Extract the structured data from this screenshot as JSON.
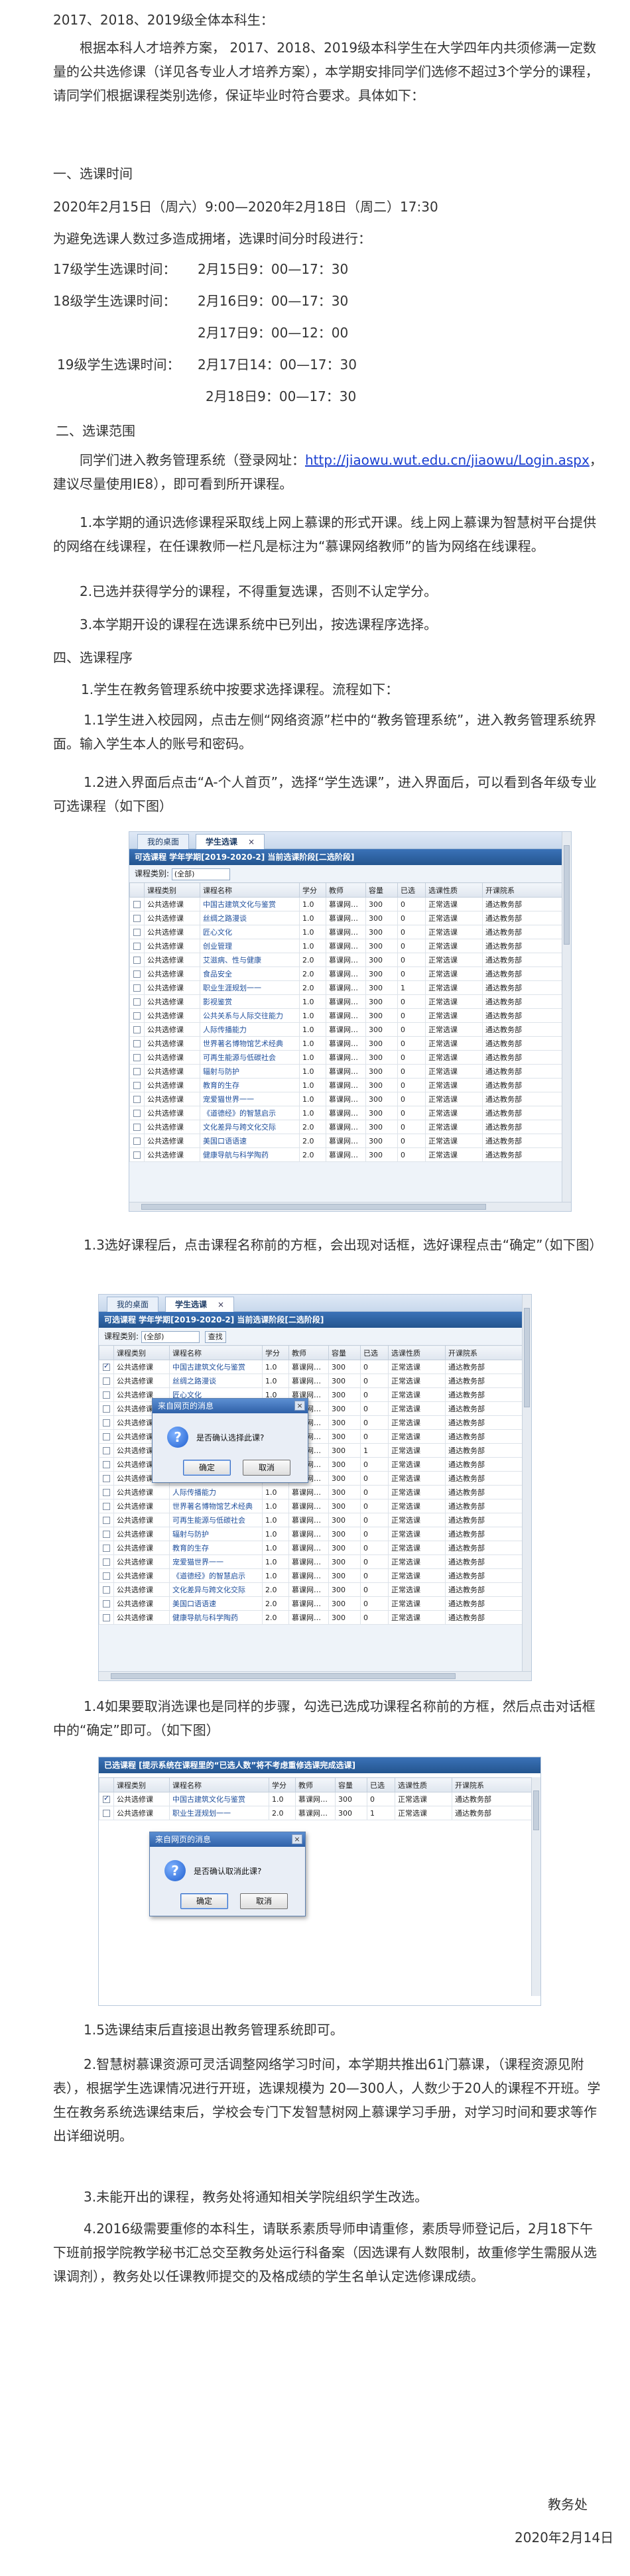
{
  "intro": {
    "audience": "2017、2018、2019级全体本科生：",
    "body": "根据本科人才培养方案， 2017、2018、2019级本科学生在大学四年内共须修满一定数量的公共选修课（详见各专业人才培养方案），本学期安排同学们选修不超过3个学分的课程，请同学们根据课程类别选修，保证毕业时符合要求。具体如下："
  },
  "section1": {
    "heading": "一、选课时间",
    "period": "2020年2月15日（周六）9:00—2020年2月18日（周二）17:30",
    "note": "为避免选课人数过多造成拥堵，选课时间分时段进行：",
    "rows": [
      {
        "grade": "17级学生选课时间：",
        "time": "2月15日9：00—17：30"
      },
      {
        "grade": "18级学生选课时间：",
        "time": "2月16日9：00—17：30"
      },
      {
        "grade": "",
        "time": "2月17日9：00—12：00"
      },
      {
        "grade": "19级学生选课时间：",
        "time": "2月17日14：00—17：30"
      },
      {
        "grade": "",
        "time": "2月18日9：00—17：30"
      }
    ]
  },
  "section2": {
    "heading": "二、选课范围",
    "p1_before": "同学们进入教务管理系统（登录网址：",
    "p1_link": "http://jiaowu.wut.edu.cn/jiaowu/Login.aspx",
    "p1_after": "，建议尽量使用IE8），即可看到所开课程。",
    "p2": "1.本学期的通识选修课程采取线上网上慕课的形式开课。线上网上慕课为智慧树平台提供的网络在线课程，在任课教师一栏凡是标注为“慕课网络教师”的皆为网络在线课程。",
    "p3": "2.已选并获得学分的课程，不得重复选课，否则不认定学分。",
    "p4": "3.本学期开设的课程在选课系统中已列出，按选课程序选择。"
  },
  "section4": {
    "heading": "四、选课程序",
    "s1": "1.学生在教务管理系统中按要求选择课程。流程如下：",
    "s11": "1.1学生进入校园网，点击左侧“网络资源”栏中的“教务管理系统”，进入教务管理系统界面。输入学生本人的账号和密码。",
    "s12": "1.2进入界面后点击“A-个人首页”，选择“学生选课”，进入界面后，可以看到各年级专业可选课程（如下图）",
    "s13": "1.3选好课程后，点击课程名称前的方框，会出现对话框，选好课程点击“确定”（如下图）",
    "s14": "1.4如果要取消选课也是同样的步骤，勾选已选成功课程名称前的方框，然后点击对话框中的“确定”即可。（如下图）",
    "s15": "1.5选课结束后直接退出教务管理系统即可。",
    "s2": "2.智慧树慕课资源可灵活调整网络学习时间，本学期共推出61门慕课，（课程资源见附表），根据学生选课情况进行开班，选课规模为 20—300人，人数少于20人的课程不开班。学生在教务系统选课结束后，学校会专门下发智慧树网上慕课学习手册，对学习时间和要求等作出详细说明。",
    "s3": "3.未能开出的课程，教务处将通知相关学院组织学生改选。",
    "s4": "4.2016级需要重修的本科生，请联系素质导师申请重修，素质导师登记后，2月18下午下班前报学院教学秘书汇总交至教务处运行科备案（因选课有人数限制，故重修学生需服从选课调剂），教务处以任课教师提交的及格成绩的学生名单认定选修课成绩。"
  },
  "footer": {
    "org": "教务处",
    "date": "2020年2月14日"
  },
  "shots": {
    "tabs": [
      "我的桌面",
      "学生选课"
    ],
    "close_mark": "×",
    "title": "可选课程  学年学期[2019-2020-2]   当前选课阶段[二选阶段]",
    "filter_label": "课程类别:",
    "filter_value": "(全部)",
    "filter_button": "查找",
    "headers": [
      "课程类别",
      "课程名称",
      "学分",
      "教师",
      "容量",
      "已选",
      "选课性质",
      "开课院系"
    ],
    "rows": [
      [
        "公共选修课",
        "中国古建筑文化与鉴赏",
        "1.0",
        "慕课网…",
        "300",
        "0",
        "正常选课",
        "通达教务部"
      ],
      [
        "公共选修课",
        "丝绸之路漫谈",
        "1.0",
        "慕课网…",
        "300",
        "0",
        "正常选课",
        "通达教务部"
      ],
      [
        "公共选修课",
        "匠心文化",
        "1.0",
        "慕课网…",
        "300",
        "0",
        "正常选课",
        "通达教务部"
      ],
      [
        "公共选修课",
        "创业管理",
        "1.0",
        "慕课网…",
        "300",
        "0",
        "正常选课",
        "通达教务部"
      ],
      [
        "公共选修课",
        "艾滋病、性与健康",
        "2.0",
        "慕课网…",
        "300",
        "0",
        "正常选课",
        "通达教务部"
      ],
      [
        "公共选修课",
        "食品安全",
        "2.0",
        "慕课网…",
        "300",
        "0",
        "正常选课",
        "通达教务部"
      ],
      [
        "公共选修课",
        "职业生涯规划一一",
        "2.0",
        "慕课网…",
        "300",
        "1",
        "正常选课",
        "通达教务部"
      ],
      [
        "公共选修课",
        "影视鉴赏",
        "1.0",
        "慕课网…",
        "300",
        "0",
        "正常选课",
        "通达教务部"
      ],
      [
        "公共选修课",
        "公共关系与人际交往能力",
        "1.0",
        "慕课网…",
        "300",
        "0",
        "正常选课",
        "通达教务部"
      ],
      [
        "公共选修课",
        "人际传播能力",
        "1.0",
        "慕课网…",
        "300",
        "0",
        "正常选课",
        "通达教务部"
      ],
      [
        "公共选修课",
        "世界著名博物馆艺术经典",
        "1.0",
        "慕课网…",
        "300",
        "0",
        "正常选课",
        "通达教务部"
      ],
      [
        "公共选修课",
        "可再生能源与低碳社会",
        "1.0",
        "慕课网…",
        "300",
        "0",
        "正常选课",
        "通达教务部"
      ],
      [
        "公共选修课",
        "辐射与防护",
        "1.0",
        "慕课网…",
        "300",
        "0",
        "正常选课",
        "通达教务部"
      ],
      [
        "公共选修课",
        "教育的生存",
        "1.0",
        "慕课网…",
        "300",
        "0",
        "正常选课",
        "通达教务部"
      ],
      [
        "公共选修课",
        "宠爱猫世界一一",
        "1.0",
        "慕课网…",
        "300",
        "0",
        "正常选课",
        "通达教务部"
      ],
      [
        "公共选修课",
        "《道德经》的智慧启示",
        "1.0",
        "慕课网…",
        "300",
        "0",
        "正常选课",
        "通达教务部"
      ],
      [
        "公共选修课",
        "文化差异与跨文化交际",
        "2.0",
        "慕课网…",
        "300",
        "0",
        "正常选课",
        "通达教务部"
      ],
      [
        "公共选修课",
        "美国口语语速",
        "2.0",
        "慕课网…",
        "300",
        "0",
        "正常选课",
        "通达教务部"
      ],
      [
        "公共选修课",
        "健康导航与科学陶药",
        "2.0",
        "慕课网…",
        "300",
        "0",
        "正常选课",
        "通达教务部"
      ]
    ],
    "dialog_title": "来自网页的消息",
    "dialog_confirm_msg": "是否确认选择此课?",
    "dialog_cancel_msg": "是否确认取消此课?",
    "ok": "确定",
    "cancel": "取消",
    "selected_title": "已选课程 [提示系统在课程里的“已选人数”将不考虑重修选课完成选课]",
    "selected_rows": [
      [
        "公共选修课",
        "中国古建筑文化与鉴赏",
        "1.0",
        "慕课网…",
        "300",
        "0",
        "正常选课",
        "通达教务部"
      ],
      [
        "公共选修课",
        "职业生涯规划一一",
        "2.0",
        "慕课网…",
        "300",
        "1",
        "正常选课",
        "通达教务部"
      ]
    ]
  }
}
